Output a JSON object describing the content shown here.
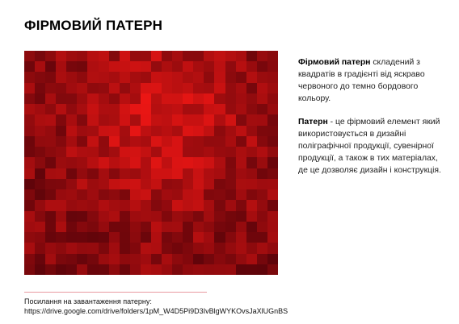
{
  "title": "ФІРМОВИЙ ПАТЕРН",
  "description": {
    "p1_bold": "Фірмовий патерн",
    "p1_rest": " складений з квадратів в градієнті від яскраво червоного до темно бордового кольору.",
    "p2_bold": "Патерн",
    "p2_rest": " - це фірмовий елемент який використовується в дизайні поліграфічної продукції, сувенірної продукції, а також в тих матеріалах, де це дозволяє дизайн і конструкція."
  },
  "footer": {
    "label": "Посилання на завантаження патерну:",
    "link": "https://drive.google.com/drive/folders/1pM_W4D5Pi9D3IvBlgWYKOvsJaXlUGnBS"
  },
  "pattern": {
    "cols": 24,
    "rows": 21
  },
  "colors": {
    "divider": "#e89aa0",
    "bright_red": "#e3120f",
    "dark_burgundy": "#6a0b12"
  }
}
